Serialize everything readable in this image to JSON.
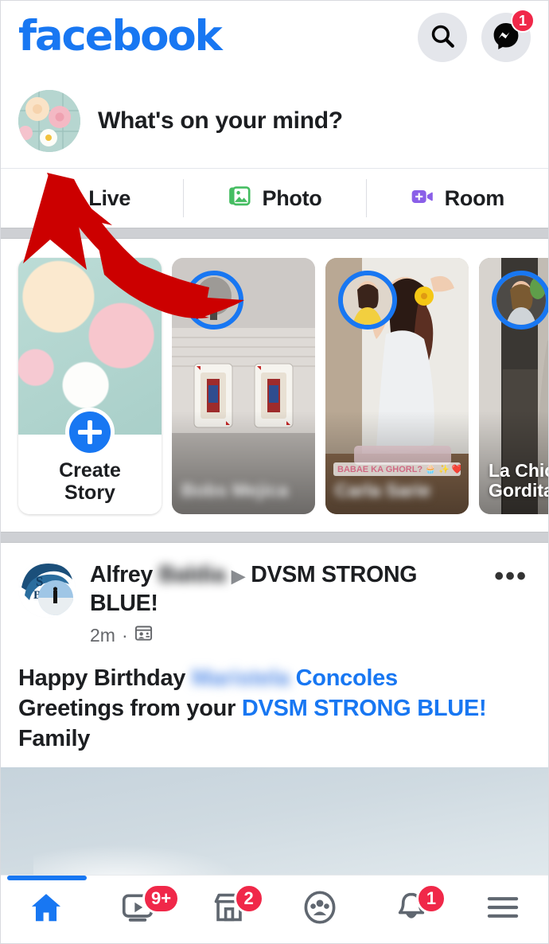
{
  "app": {
    "name": "Facebook",
    "platform": "mobile"
  },
  "header": {
    "wordmark": "facebook",
    "search_icon": "search-icon",
    "messenger_icon": "messenger-icon",
    "messenger_badge": "1",
    "brand_color": "#1877F2",
    "badge_color": "#F02849"
  },
  "composer": {
    "prompt": "What's on your mind?",
    "avatar_alt": "user-profile-photo-flowers",
    "actions": [
      {
        "label": "Live",
        "icon": "live-video-icon",
        "color": "#F3425F"
      },
      {
        "label": "Photo",
        "icon": "photo-library-icon",
        "color": "#45BD62"
      },
      {
        "label": "Room",
        "icon": "video-room-icon",
        "color": "#8A5FE8"
      }
    ]
  },
  "stories": {
    "create": {
      "label_line1": "Create",
      "label_line2": "Story",
      "plus_icon": "plus-icon"
    },
    "items": [
      {
        "name": "Bobs Mejica",
        "blurred": true,
        "sticker": ""
      },
      {
        "name": "Carla Sarie",
        "blurred": true,
        "sticker": "BABAE KA GHORL? 🧁 ✨ ❤️"
      },
      {
        "name": "La Chica Gordita",
        "blurred": false,
        "sticker": ""
      }
    ]
  },
  "post": {
    "author": "Alfrey",
    "author_blurred": "Baldia",
    "group_separator_icon": "caret-right-icon",
    "group": "DVSM STRONG BLUE!",
    "timestamp": "2m",
    "separator": "·",
    "audience_icon": "group-audience-icon",
    "more_icon": "more-options-icon",
    "more_glyph": "•••",
    "body": {
      "part1": "Happy Birthday ",
      "mention_blurred": "Maristela",
      "mention": " Concoles",
      "part2": "Greetings from your ",
      "mention2": "DVSM STRONG BLUE!",
      "part3": " Family"
    },
    "avatar_alt": "dvsm-strong-blue-logo",
    "photo_alt": "sky-photo"
  },
  "bottom_nav": {
    "items": [
      {
        "name": "home",
        "icon": "home-icon",
        "active": true,
        "badge": ""
      },
      {
        "name": "watch",
        "icon": "watch-video-icon",
        "active": false,
        "badge": "9+"
      },
      {
        "name": "marketplace",
        "icon": "marketplace-store-icon",
        "active": false,
        "badge": "2"
      },
      {
        "name": "groups",
        "icon": "groups-icon",
        "active": false,
        "badge": ""
      },
      {
        "name": "notifications",
        "icon": "bell-notification-icon",
        "active": false,
        "badge": "1"
      },
      {
        "name": "menu",
        "icon": "hamburger-menu-icon",
        "active": false,
        "badge": ""
      }
    ]
  },
  "annotation": {
    "arrow_color": "#CC0000",
    "arrow_description": "red-curved-arrow-pointing-to-profile-photo"
  }
}
